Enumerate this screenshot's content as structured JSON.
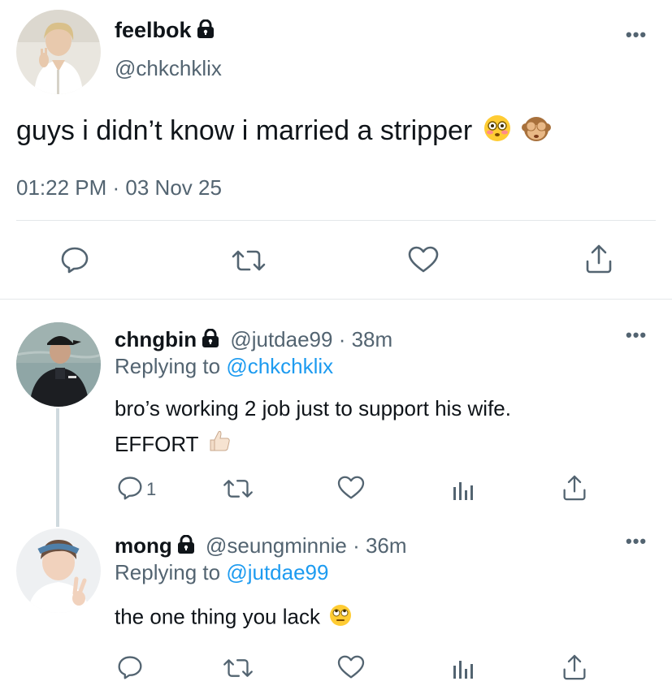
{
  "main_tweet": {
    "display_name": "feelbok",
    "handle": "@chkchklix",
    "text": "guys i didn’t know i married a stripper",
    "emojis": [
      "flushed-face",
      "see-no-evil-monkey"
    ],
    "timestamp": "01:22 PM · 03 Nov 25",
    "actions": [
      "reply-icon",
      "retweet-icon",
      "like-icon",
      "share-icon"
    ]
  },
  "replies": [
    {
      "display_name": "chngbin",
      "handle": "@jutdae99",
      "time": "· 38m",
      "replying_prefix": "Replying to",
      "replying_to": "@chkchklix",
      "text_line1": "bro’s working 2 job just to support his wife.",
      "text_line2": "EFFORT",
      "emoji": "thumbs-up",
      "reply_count": "1"
    },
    {
      "display_name": "mong",
      "handle": "@seungminnie",
      "time": "· 36m",
      "replying_prefix": "Replying to",
      "replying_to": "@jutdae99",
      "text": "the one thing you lack",
      "emoji": "face-with-rolling-eyes"
    }
  ],
  "colors": {
    "text": "#0f1419",
    "secondary": "#536471",
    "link": "#1d9bf0",
    "divider": "#e4e7ea"
  }
}
